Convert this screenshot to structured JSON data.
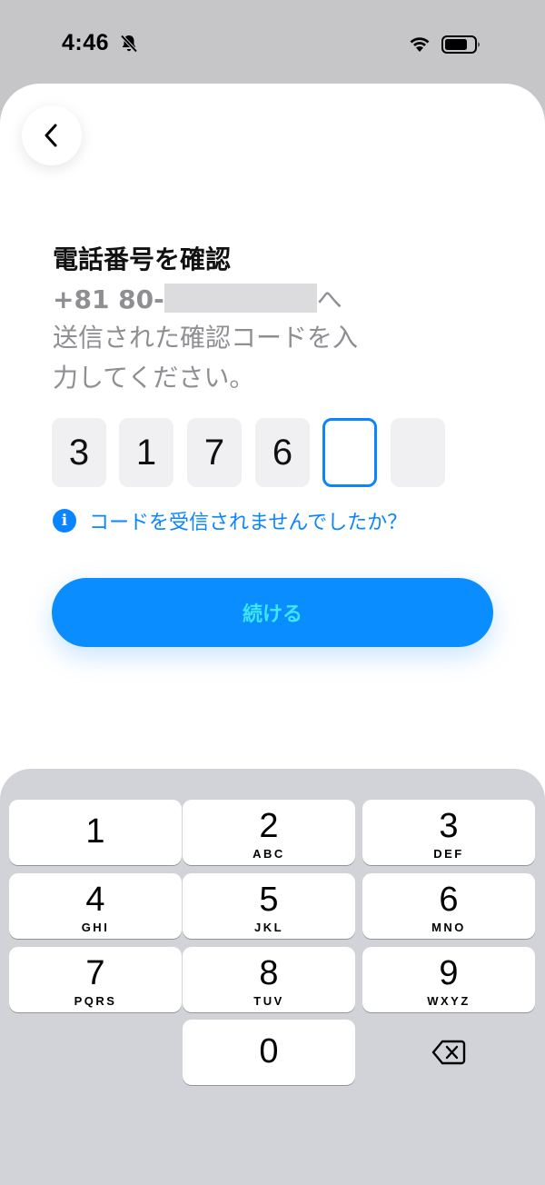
{
  "status_bar": {
    "time": "4:46",
    "icons": [
      "bell-slash-icon",
      "wifi-icon",
      "battery-icon"
    ]
  },
  "header": {
    "back_icon": "chevron-left-icon"
  },
  "content": {
    "title": "電話番号を確認",
    "phone_prefix": "+81 80-",
    "phone_suffix": "へ",
    "subtitle": "送信された確認コードを入力してください。"
  },
  "otp": {
    "digits": [
      "3",
      "1",
      "7",
      "6",
      "",
      ""
    ],
    "active_index": 4
  },
  "help": {
    "icon": "info-icon",
    "text": "コードを受信されませんでしたか？"
  },
  "continue_button": {
    "label": "続ける"
  },
  "keypad": {
    "keys": [
      {
        "num": "1",
        "letters": ""
      },
      {
        "num": "2",
        "letters": "ABC"
      },
      {
        "num": "3",
        "letters": "DEF"
      },
      {
        "num": "4",
        "letters": "GHI"
      },
      {
        "num": "5",
        "letters": "JKL"
      },
      {
        "num": "6",
        "letters": "MNO"
      },
      {
        "num": "7",
        "letters": "PQRS"
      },
      {
        "num": "8",
        "letters": "TUV"
      },
      {
        "num": "9",
        "letters": "WXYZ"
      },
      {
        "num": "0",
        "letters": ""
      }
    ],
    "delete_icon": "backspace-icon"
  },
  "colors": {
    "accent": "#0a84ff",
    "button_bg": "#0a8dff",
    "button_text": "#3ee6f4",
    "keyboard_bg": "#d1d3d9",
    "status_bg": "#c6c6c9"
  }
}
